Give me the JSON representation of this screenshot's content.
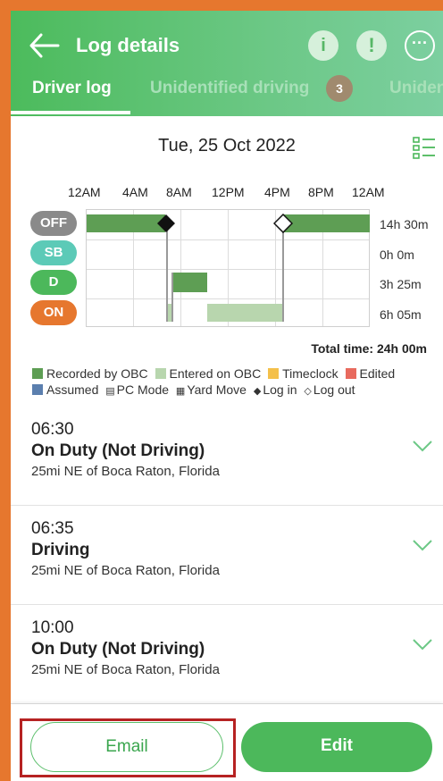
{
  "header": {
    "title": "Log details",
    "tabs": [
      {
        "label": "Driver log"
      },
      {
        "label": "Unidentified driving",
        "badge": "3"
      },
      {
        "label": "Uniden"
      }
    ]
  },
  "chart": {
    "date": "Tue, 25 Oct 2022",
    "time_ticks": [
      "12AM",
      "4AM",
      "8AM",
      "12PM",
      "4PM",
      "8PM",
      "12AM"
    ],
    "rows": [
      {
        "status": "OFF",
        "duration": "14h 30m"
      },
      {
        "status": "SB",
        "duration": "0h 0m"
      },
      {
        "status": "D",
        "duration": "3h 25m"
      },
      {
        "status": "ON",
        "duration": "6h 05m"
      }
    ],
    "total": "Total time: 24h 00m",
    "colors": {
      "off_pill": "#8a8a8a",
      "sb_pill": "#5ccab7",
      "d_pill": "#4cb85b",
      "on_pill": "#e6772e",
      "recorded": "#5e9e54",
      "entered": "#b8d6ae"
    }
  },
  "legend": {
    "recorded": "Recorded by OBC",
    "entered": "Entered on OBC",
    "timeclock": "Timeclock",
    "edited": "Edited",
    "assumed": "Assumed",
    "pc_mode": "PC Mode",
    "yard_move": "Yard Move",
    "log_in": "Log in",
    "log_out": "Log out"
  },
  "events": [
    {
      "time": "06:30",
      "status": "On Duty (Not Driving)",
      "location": "25mi NE of Boca Raton, Florida"
    },
    {
      "time": "06:35",
      "status": "Driving",
      "location": "25mi NE of Boca Raton, Florida"
    },
    {
      "time": "10:00",
      "status": "On Duty (Not Driving)",
      "location": "25mi NE of Boca Raton, Florida"
    }
  ],
  "footer": {
    "email_label": "Email",
    "edit_label": "Edit"
  }
}
